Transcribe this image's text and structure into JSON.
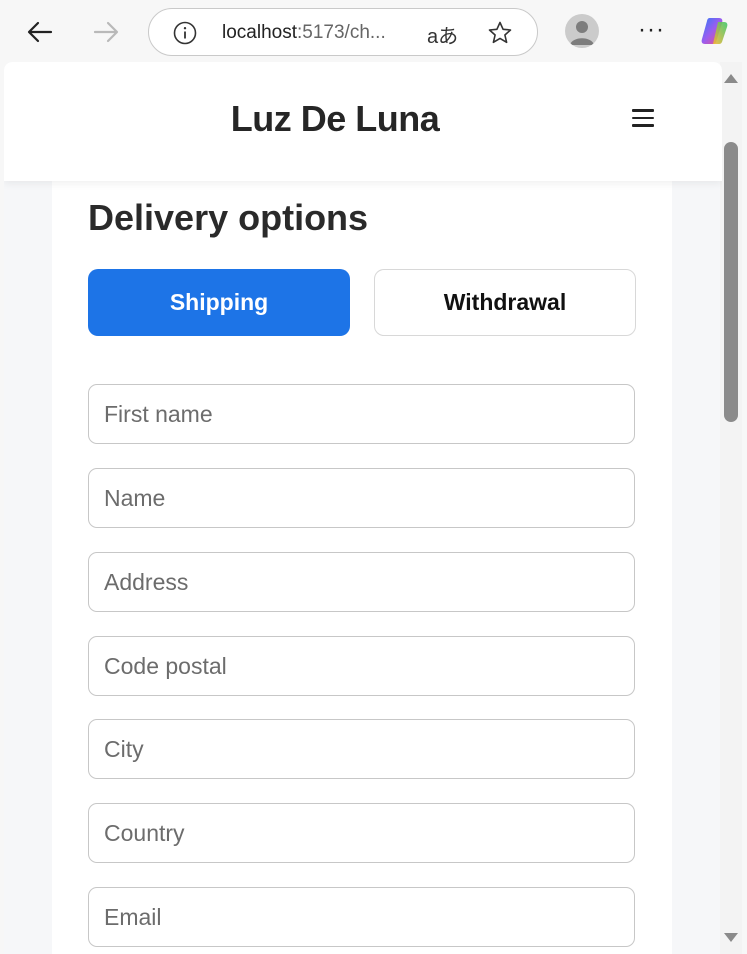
{
  "browser": {
    "url_host": "localhost",
    "url_rest": ":5173/ch...",
    "read_aloud_label": "aあ",
    "more_label": "···"
  },
  "header": {
    "brand": "Luz De Luna"
  },
  "checkout": {
    "title": "Delivery options",
    "tabs": [
      {
        "label": "Shipping",
        "active": true
      },
      {
        "label": "Withdrawal",
        "active": false
      }
    ],
    "fields": {
      "first_name": {
        "placeholder": "First name",
        "value": ""
      },
      "name": {
        "placeholder": "Name",
        "value": ""
      },
      "address": {
        "placeholder": "Address",
        "value": ""
      },
      "postal": {
        "placeholder": "Code postal",
        "value": ""
      },
      "city": {
        "placeholder": "City",
        "value": ""
      },
      "country": {
        "placeholder": "Country",
        "value": ""
      },
      "email": {
        "placeholder": "Email",
        "value": ""
      }
    }
  },
  "colors": {
    "accent": "#1d74e7",
    "text": "#2a2a2a",
    "border": "#c7c7c7"
  },
  "icons": [
    "back-arrow-icon",
    "forward-arrow-icon",
    "info-icon",
    "star-icon",
    "profile-icon",
    "copilot-icon",
    "hamburger-menu-icon"
  ]
}
